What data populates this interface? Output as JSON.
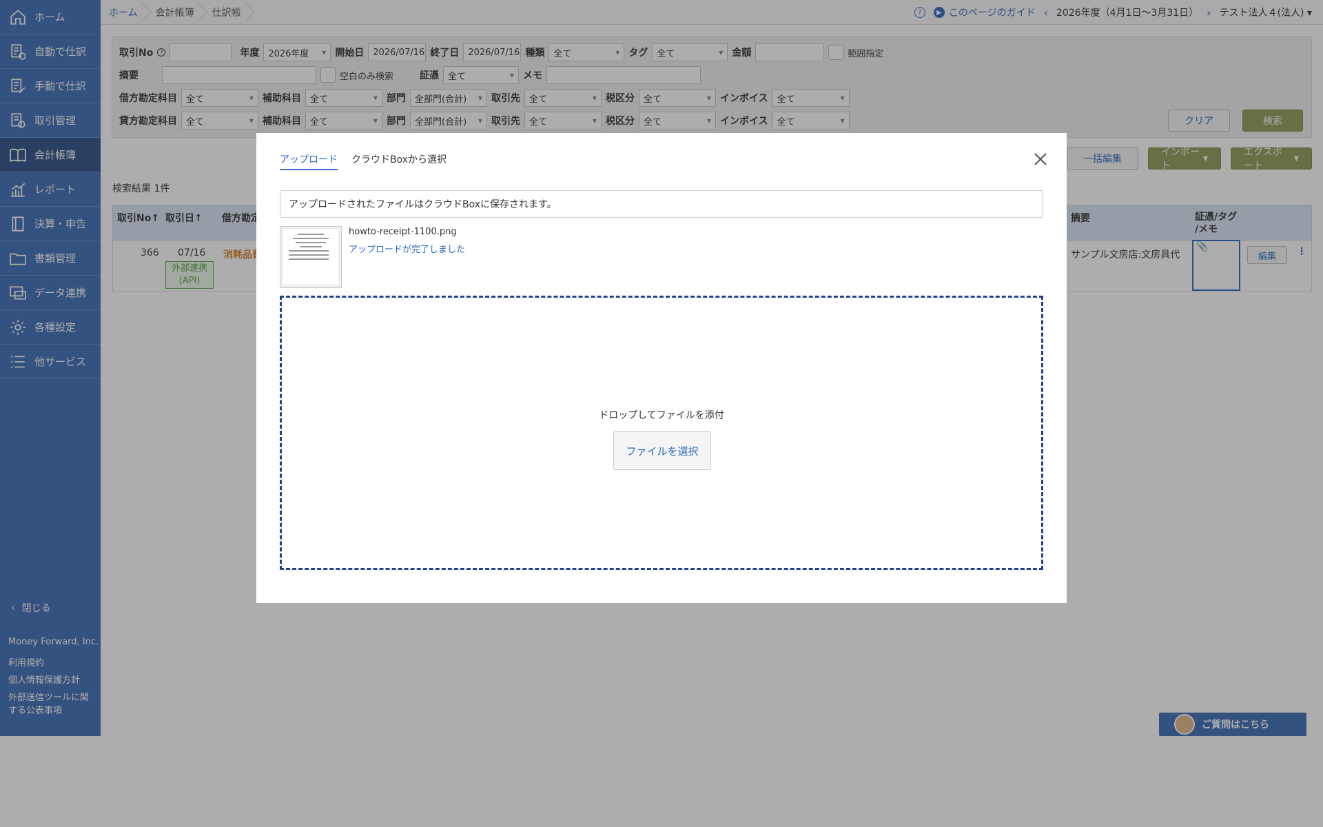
{
  "sidebar": {
    "items": [
      {
        "label": "ホーム",
        "icon": "home-icon"
      },
      {
        "label": "自動で仕訳",
        "icon": "auto-journal-icon"
      },
      {
        "label": "手動で仕訳",
        "icon": "manual-journal-icon"
      },
      {
        "label": "取引管理",
        "icon": "transaction-icon"
      },
      {
        "label": "会計帳簿",
        "icon": "book-icon"
      },
      {
        "label": "レポート",
        "icon": "report-icon"
      },
      {
        "label": "決算・申告",
        "icon": "settlement-icon"
      },
      {
        "label": "書類管理",
        "icon": "folder-icon"
      },
      {
        "label": "データ連携",
        "icon": "data-link-icon"
      },
      {
        "label": "各種設定",
        "icon": "gear-icon"
      },
      {
        "label": "他サービス",
        "icon": "list-icon"
      }
    ],
    "close_label": "閉じる",
    "company": "Money Forward, Inc.",
    "links": [
      "利用規約",
      "個人情報保護方針",
      "外部送信ツールに関する公表事項"
    ]
  },
  "header": {
    "breadcrumbs": [
      "ホーム",
      "会計帳簿",
      "仕訳帳"
    ],
    "guide_label": "このページのガイド",
    "fiscal_year": "2026年度（4月1日〜3月31日）",
    "company": "テスト法人４(法人)"
  },
  "search": {
    "labels": {
      "txno": "取引No",
      "year": "年度",
      "start": "開始日",
      "end": "終了日",
      "kind": "種類",
      "tag": "タグ",
      "amount": "金額",
      "range": "範囲指定",
      "summary": "摘要",
      "blank_only": "空白のみ検索",
      "evidence": "証憑",
      "memo": "メモ",
      "debit": "借方勘定科目",
      "credit": "貸方勘定科目",
      "sub": "補助科目",
      "dept": "部門",
      "partner": "取引先",
      "tax": "税区分",
      "invoice": "インボイス"
    },
    "values": {
      "year": "2026年度",
      "start": "2026/07/16",
      "end": "2026/07/16",
      "all": "全て",
      "dept_all": "全部門(合計)"
    },
    "clear_label": "クリア",
    "search_label": "検索"
  },
  "toolbar": {
    "bulk_edit": "一括編集",
    "import": "インポート",
    "export": "エクスポート"
  },
  "results": {
    "count_label": "検索結果 1件",
    "headers": {
      "txno": "取引No",
      "date": "取引日",
      "debit": "借方勘定",
      "summary": "摘要",
      "evidence_line1": "証憑/タグ",
      "evidence_line2": "/メモ"
    },
    "row": {
      "txno": "366",
      "date": "07/16",
      "badge_line1": "外部連携",
      "badge_line2": "(API)",
      "debit_partial": "消耗品費",
      "summary": "サンプル文房店:文房具代",
      "edit_label": "編集"
    }
  },
  "modal": {
    "tabs": [
      "アップロード",
      "クラウドBoxから選択"
    ],
    "notice": "アップロードされたファイルはクラウドBoxに保存されます。",
    "file_name": "howto-receipt-1100.png",
    "file_status": "アップロードが完了しました",
    "drop_text": "ドロップしてファイルを添付",
    "select_button": "ファイルを選択"
  },
  "help": {
    "label": "ご質問はこちら"
  },
  "colors": {
    "sidebar": "#3d6cb5",
    "accent": "#2e6ac0",
    "drop_border": "#25408c",
    "api_badge": "#5ba24d",
    "debit_text": "#d9822b"
  }
}
